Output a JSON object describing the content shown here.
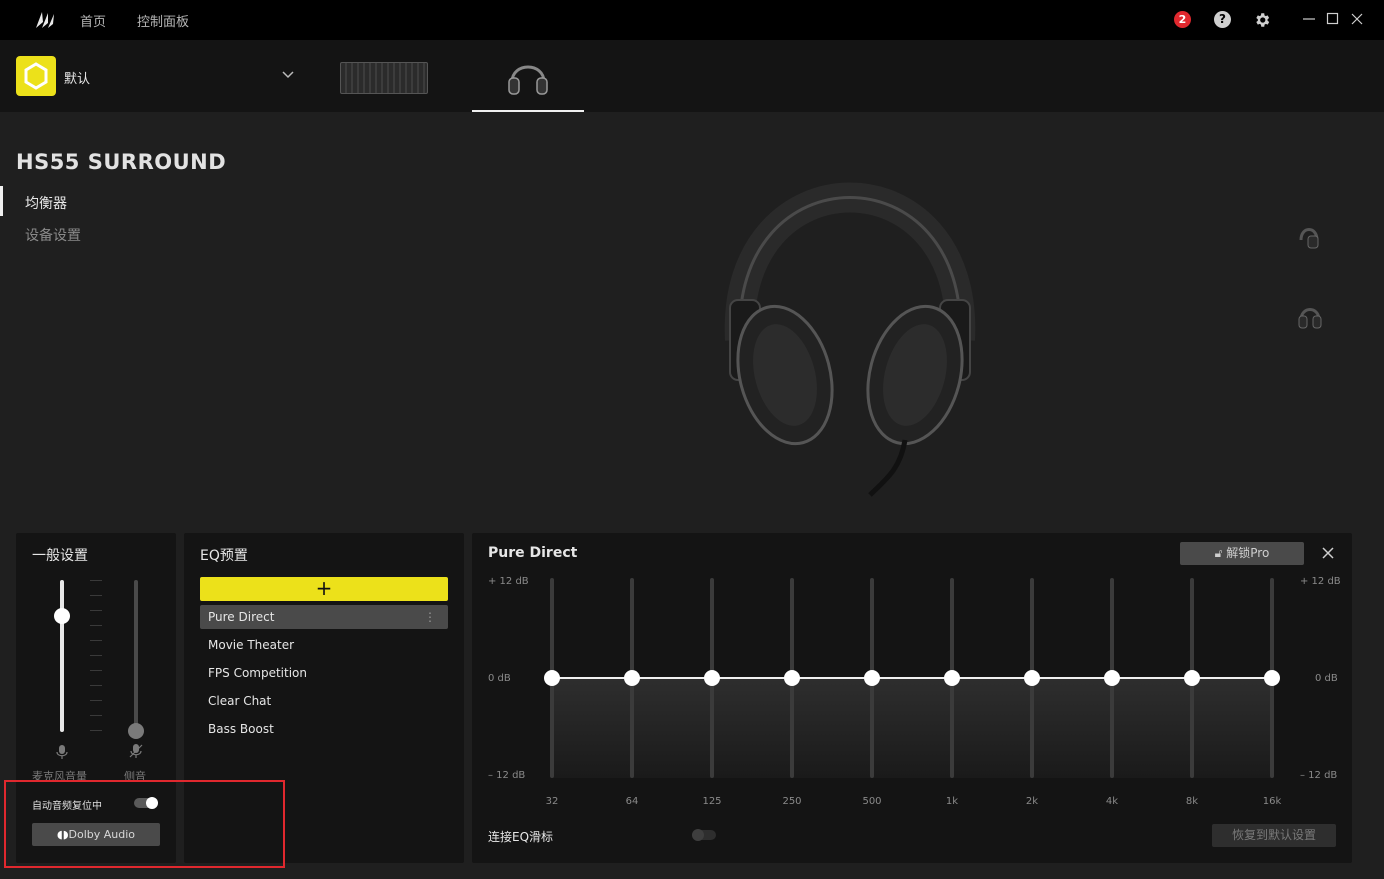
{
  "titlebar": {
    "nav": [
      "首页",
      "控制面板"
    ],
    "notification_count": "2",
    "help_glyph": "?",
    "window_controls": [
      "minimize-icon",
      "maximize-icon",
      "close-icon"
    ]
  },
  "device_bar": {
    "profile_name": "默认",
    "devices": [
      "keyboard",
      "headset"
    ],
    "selected_device": "headset"
  },
  "device": {
    "title": "HS55 SURROUND",
    "sidebar": [
      {
        "label": "均衡器",
        "active": true
      },
      {
        "label": "设备设置",
        "active": false
      }
    ]
  },
  "general": {
    "title": "一般设置",
    "mic_label": "麦克风音量",
    "sidetone_label": "侧音",
    "auto_reset_label": "自动音频复位中",
    "auto_reset_on": true,
    "dolby_label": "Dolby Audio"
  },
  "eq_presets": {
    "title": "EQ预置",
    "add_glyph": "+",
    "items": [
      "Pure Direct",
      "Movie Theater",
      "FPS Competition",
      "Clear Chat",
      "Bass Boost"
    ],
    "selected": "Pure Direct"
  },
  "eq": {
    "title": "Pure Direct",
    "unlock_label": "解锁Pro",
    "db_top": "+ 12 dB",
    "db_mid": "0 dB",
    "db_bottom": "– 12 dB",
    "bands": [
      "32",
      "64",
      "125",
      "250",
      "500",
      "1k",
      "2k",
      "4k",
      "8k",
      "16k"
    ],
    "gains_db": [
      0,
      0,
      0,
      0,
      0,
      0,
      0,
      0,
      0,
      0
    ],
    "link_label": "连接EQ滑标",
    "link_on": false,
    "reset_label": "恢复到默认设置"
  },
  "colors": {
    "accent": "#ece11a",
    "badge": "#e0282e"
  }
}
